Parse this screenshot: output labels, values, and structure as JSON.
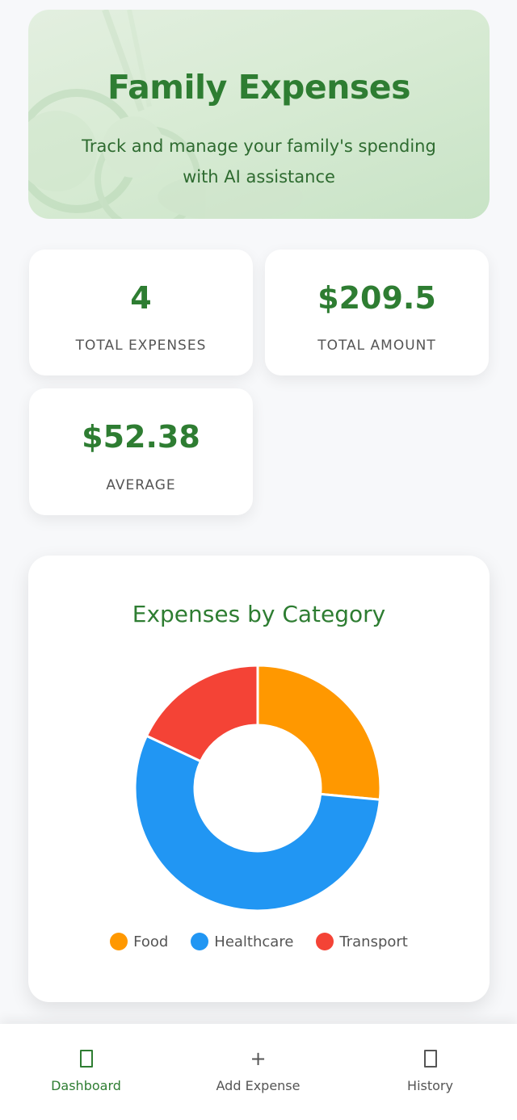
{
  "hero": {
    "title": "Family Expenses",
    "subtitle": "Track and manage your family's spending with AI assistance"
  },
  "stats": {
    "total_expenses": {
      "value": "4",
      "label": "TOTAL EXPENSES"
    },
    "total_amount": {
      "value": "$209.5",
      "label": "TOTAL AMOUNT"
    },
    "average": {
      "value": "$52.38",
      "label": "AVERAGE"
    }
  },
  "chart_data": {
    "type": "pie",
    "title": "Expenses by Category",
    "categories": [
      "Food",
      "Healthcare",
      "Transport"
    ],
    "values": [
      26.5,
      55.5,
      18
    ],
    "colors": [
      "#ff9800",
      "#2196f3",
      "#f44336"
    ],
    "legend_position": "bottom"
  },
  "nav": {
    "dashboard": {
      "label": "Dashboard",
      "icon": "square-icon",
      "active": true
    },
    "add_expense": {
      "label": "Add Expense",
      "icon": "plus-icon"
    },
    "history": {
      "label": "History",
      "icon": "square-icon"
    }
  },
  "colors": {
    "accent": "#2e7d32",
    "text_muted": "#555555",
    "background": "#f7f8fa"
  }
}
